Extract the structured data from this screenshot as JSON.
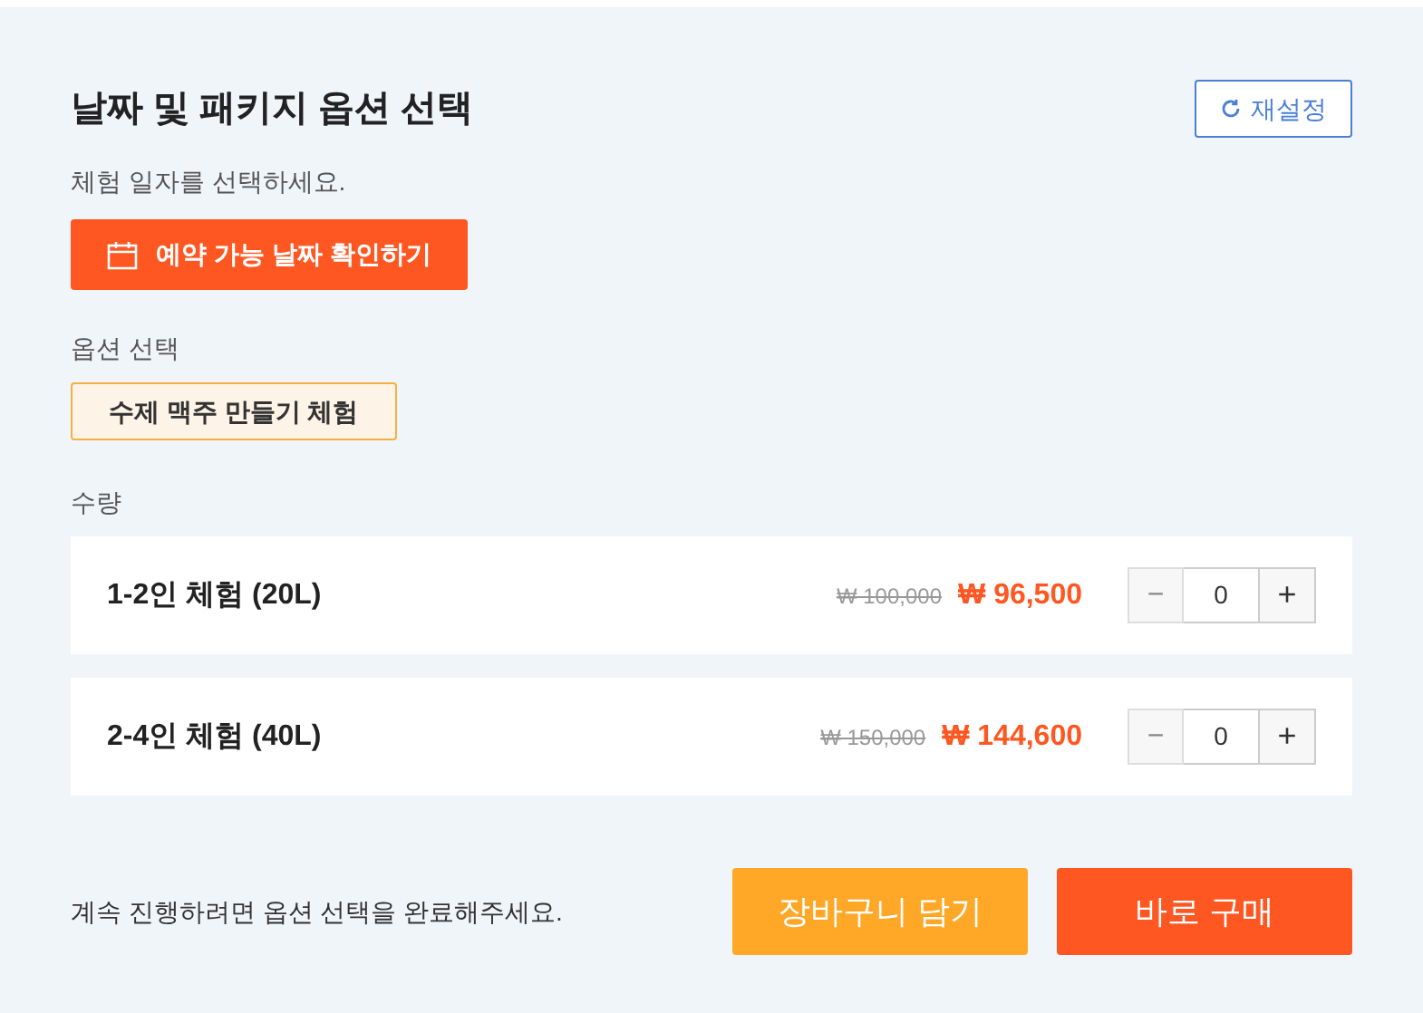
{
  "title": "날짜 및 패키지 옵션 선택",
  "reset_button": "재설정",
  "date_prompt": "체험 일자를 선택하세요.",
  "date_button": "예약 가능 날짜 확인하기",
  "option_label": "옵션 선택",
  "options": [
    {
      "label": "수제 맥주 만들기 체험",
      "selected": true
    }
  ],
  "quantity_label": "수량",
  "items": [
    {
      "name": "1-2인 체험 (20L)",
      "original_price": "₩ 100,000",
      "price": "₩ 96,500",
      "quantity": "0",
      "minus_symbol": "−",
      "plus_symbol": "+",
      "minus_disabled": true
    },
    {
      "name": "2-4인 체험 (40L)",
      "original_price": "₩ 150,000",
      "price": "₩ 144,600",
      "quantity": "0",
      "minus_symbol": "−",
      "plus_symbol": "+",
      "minus_disabled": true
    }
  ],
  "footer_note": "계속 진행하려면 옵션 선택을 완료해주세요.",
  "cart_button": "장바구니 담기",
  "buy_button": "바로 구매"
}
